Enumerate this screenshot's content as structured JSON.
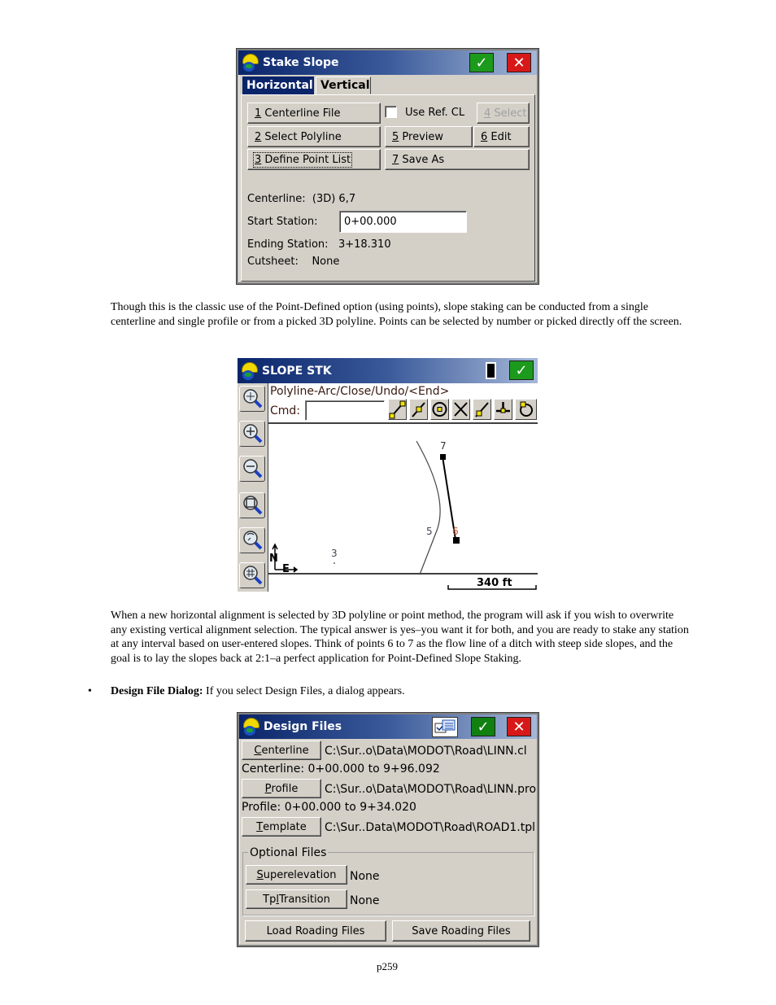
{
  "stake_slope_dialog": {
    "title": "Stake Slope",
    "tabs": [
      {
        "label": "Horizontal",
        "active": true
      },
      {
        "label": "Vertical",
        "active": false
      }
    ],
    "buttons": {
      "centerline_file": {
        "key": "1",
        "label": " Centerline File"
      },
      "select_polyline": {
        "key": "2",
        "label": " Select Polyline"
      },
      "define_point_list": {
        "key": "3",
        "label": " Define Point List"
      },
      "select": {
        "key": "4",
        "label": " Select"
      },
      "preview": {
        "key": "5",
        "label": " Preview"
      },
      "edit": {
        "key": "6",
        "label": " Edit"
      },
      "save_as": {
        "key": "7",
        "label": " Save As"
      }
    },
    "use_ref_cl": {
      "label": "Use Ref. CL",
      "checked": false
    },
    "centerline": {
      "label": "Centerline:",
      "value": "(3D) 6,7"
    },
    "start_station": {
      "label": "Start Station:",
      "value": "0+00.000"
    },
    "ending_station": {
      "label": "Ending Station:",
      "value": "3+18.310"
    },
    "cutsheet": {
      "label": "Cutsheet:",
      "value": "None"
    }
  },
  "paragraph_1": "Though this is the classic use of the Point-Defined option (using points), slope staking can be conducted from a single centerline and single profile or from a picked 3D polyline.  Points can be selected by number or picked directly off the screen.",
  "slope_stk_window": {
    "title": "SLOPE STK",
    "prompt": "Polyline-Arc/Close/Undo/<End>",
    "cmd_label": "Cmd:",
    "cmd_value": "",
    "snap_tools": [
      "snap-endpoint-icon",
      "snap-midpoint-icon",
      "snap-center-icon",
      "snap-intersection-icon",
      "snap-nearest-icon",
      "snap-perpendicular-icon",
      "snap-tangent-icon"
    ],
    "zoom_tools": [
      "zoom-extents",
      "zoom-in",
      "zoom-out",
      "zoom-window",
      "zoom-previous",
      "zoom-grid"
    ],
    "points": [
      {
        "label": "7"
      },
      {
        "label": "6"
      },
      {
        "label": "5"
      },
      {
        "label": "3"
      }
    ],
    "north_label": "N",
    "east_label": "E",
    "scale_label": "340 ft"
  },
  "paragraph_2": "When a new horizontal alignment is selected by 3D polyline or point method, the program will ask if you wish to overwrite any existing vertical alignment selection.  The typical answer is yes–you want it for both, and you are ready to stake any station at any interval based on user-entered slopes.  Think of points 6 to 7 as the flow line of a ditch with steep side slopes, and the goal is to lay the slopes back at 2:1–a perfect application for Point-Defined Slope Staking.",
  "bullet": {
    "bold": "Design File Dialog:",
    "text": " If you select Design Files, a dialog appears."
  },
  "design_files_dialog": {
    "title": "Design Files",
    "centerline": {
      "button_key": "C",
      "button_rest": "enterline",
      "path": "C:\\Sur..o\\Data\\MODOT\\Road\\LINN.cl",
      "range": "Centerline: 0+00.000 to 9+96.092"
    },
    "profile": {
      "button_key": "P",
      "button_rest": "rofile",
      "path": "C:\\Sur..o\\Data\\MODOT\\Road\\LINN.pro",
      "range": "Profile: 0+00.000 to 9+34.020"
    },
    "template": {
      "button_key": "T",
      "button_rest": "emplate",
      "path": "C:\\Sur..Data\\MODOT\\Road\\ROAD1.tpl"
    },
    "optional_files": {
      "legend": "Optional Files",
      "superelevation": {
        "button_key": "S",
        "button_rest": "uperelevation",
        "value": "None"
      },
      "tpl_transition": {
        "button_pre": "Tp",
        "button_key": "l",
        "button_rest": " Transition",
        "value": "None"
      }
    },
    "load_button": "Load Roading Files",
    "save_button": "Save Roading Files"
  },
  "page_number": "p259"
}
